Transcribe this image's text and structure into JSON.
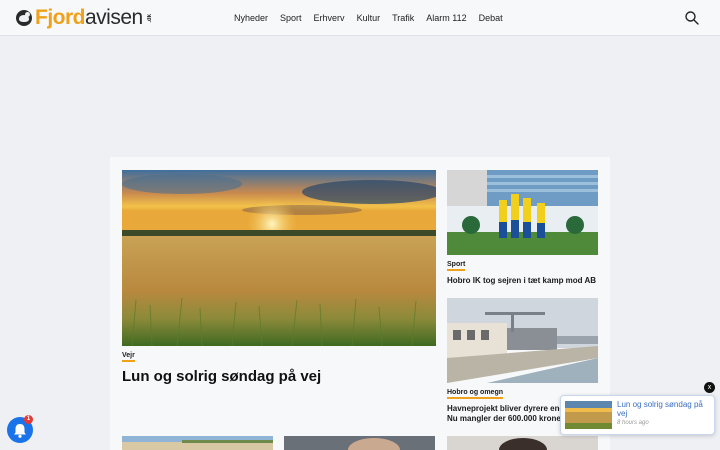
{
  "brand": {
    "name_part1": "Fjord",
    "name_part2": "avisen",
    "tld": ".dk"
  },
  "nav": {
    "items": [
      "Nyheder",
      "Sport",
      "Erhverv",
      "Kultur",
      "Trafik",
      "Alarm 112",
      "Debat"
    ]
  },
  "icons": {
    "search": "search-icon",
    "bell": "bell-icon",
    "close": "close-icon",
    "logo": "logo-mark-icon"
  },
  "colors": {
    "accent": "#f0a019",
    "popup_link": "#3a6fc4",
    "bell": "#1a73e8",
    "badge": "#e53935"
  },
  "hero": {
    "category": "Vejr",
    "title": "Lun og solrig søndag på vej"
  },
  "side_articles": [
    {
      "category": "Sport",
      "title": "Hobro IK tog sejren i tæt kamp mod AB"
    },
    {
      "category": "Hobro og omegn",
      "title": "Havneprojekt bliver dyrere end ventet: Nu mangler der 600.000 kroner"
    }
  ],
  "notifications": {
    "badge_count": "1"
  },
  "popup": {
    "title": "Lun og solrig søndag på vej",
    "time": "8 hours ago",
    "close": "x"
  }
}
